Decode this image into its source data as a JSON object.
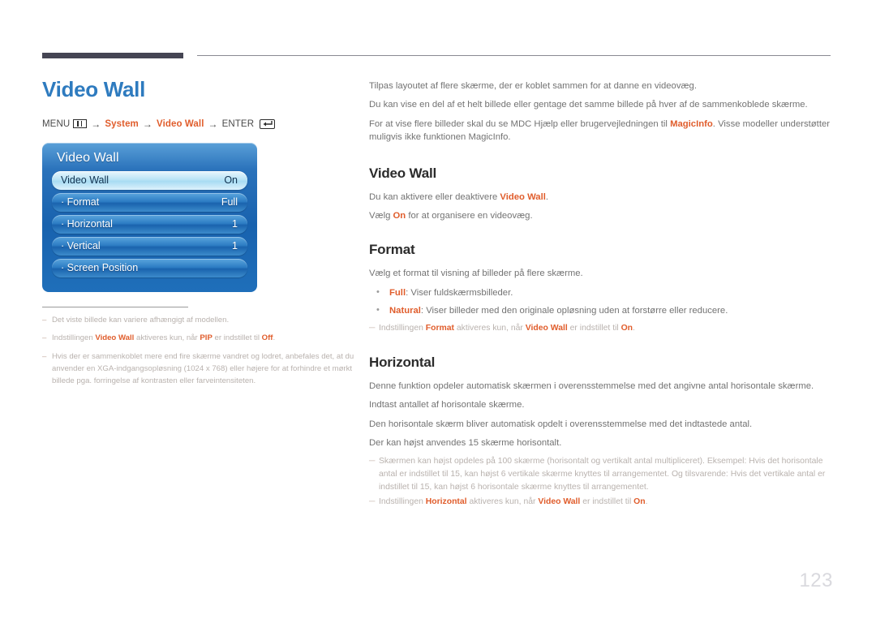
{
  "header": {
    "bar_color": "#454553",
    "line_color": "#8a8a92"
  },
  "left": {
    "page_title": "Video Wall",
    "title_color": "#2e7bbf",
    "breadcrumb": {
      "menu_label": "MENU",
      "menu_icon": "menu-bars-icon",
      "arrow": "→",
      "item1": "System",
      "item2": "Video Wall",
      "enter_label": "ENTER",
      "enter_icon": "enter-key-icon"
    },
    "osd": {
      "title": "Video Wall",
      "rows": [
        {
          "label": "Video Wall",
          "value": "On",
          "selected": true
        },
        {
          "label": "· Format",
          "value": "Full",
          "selected": false
        },
        {
          "label": "· Horizontal",
          "value": "1",
          "selected": false
        },
        {
          "label": "· Vertical",
          "value": "1",
          "selected": false
        },
        {
          "label": "· Screen Position",
          "value": "",
          "selected": false
        }
      ]
    },
    "notes": [
      {
        "dash": "–",
        "parts": [
          {
            "t": "Det viste billede kan variere afhængigt af modellen.",
            "b": false
          }
        ]
      },
      {
        "dash": "–",
        "parts": [
          {
            "t": "Indstillingen ",
            "b": false
          },
          {
            "t": "Video Wall",
            "b": true
          },
          {
            "t": " aktiveres kun, når ",
            "b": false
          },
          {
            "t": "PIP",
            "b": true
          },
          {
            "t": " er indstillet til ",
            "b": false
          },
          {
            "t": "Off",
            "b": true
          },
          {
            "t": ".",
            "b": false
          }
        ]
      },
      {
        "dash": "–",
        "parts": [
          {
            "t": "Hvis der er sammenkoblet mere end fire skærme vandret og lodret, anbefales det, at du anvender en XGA-indgangsopløsning (1024 x 768) eller højere for at forhindre et mørkt billede pga. forringelse af kontrasten eller farveintensiteten.",
            "b": false
          }
        ]
      }
    ]
  },
  "right": {
    "intro": [
      {
        "parts": [
          {
            "t": "Tilpas layoutet af flere skærme, der er koblet sammen for at danne en videovæg.",
            "b": false
          }
        ]
      },
      {
        "parts": [
          {
            "t": "Du kan vise en del af et helt billede eller gentage det samme billede på hver af de sammenkoblede skærme.",
            "b": false
          }
        ]
      },
      {
        "parts": [
          {
            "t": "For at vise flere billeder skal du se MDC Hjælp eller brugervejledningen til ",
            "b": false
          },
          {
            "t": "MagicInfo",
            "b": true
          },
          {
            "t": ". Visse modeller understøtter muligvis ikke funktionen MagicInfo.",
            "b": false
          }
        ]
      }
    ],
    "sections": [
      {
        "heading": "Video Wall",
        "paras": [
          {
            "parts": [
              {
                "t": "Du kan aktivere eller deaktivere ",
                "b": false
              },
              {
                "t": "Video Wall",
                "b": true
              },
              {
                "t": ".",
                "b": false
              }
            ]
          },
          {
            "parts": [
              {
                "t": "Vælg ",
                "b": false
              },
              {
                "t": "On",
                "b": true
              },
              {
                "t": " for at organisere en videovæg.",
                "b": false
              }
            ]
          }
        ],
        "bullets": [],
        "notes": []
      },
      {
        "heading": "Format",
        "paras": [
          {
            "parts": [
              {
                "t": "Vælg et format til visning af billeder på flere skærme.",
                "b": false
              }
            ]
          }
        ],
        "bullets": [
          {
            "dot": "•",
            "parts": [
              {
                "t": "Full",
                "b": true
              },
              {
                "t": ": Viser fuldskærmsbilleder.",
                "b": false
              }
            ]
          },
          {
            "dot": "•",
            "parts": [
              {
                "t": "Natural",
                "b": true
              },
              {
                "t": ": Viser billeder med den originale opløsning uden at forstørre eller reducere.",
                "b": false
              }
            ]
          }
        ],
        "notes": [
          {
            "dash": "─",
            "parts": [
              {
                "t": "Indstillingen ",
                "b": false
              },
              {
                "t": "Format",
                "b": true
              },
              {
                "t": " aktiveres kun, når ",
                "b": false
              },
              {
                "t": "Video Wall",
                "b": true
              },
              {
                "t": " er indstillet til ",
                "b": false
              },
              {
                "t": "On",
                "b": true
              },
              {
                "t": ".",
                "b": false
              }
            ]
          }
        ]
      },
      {
        "heading": "Horizontal",
        "paras": [
          {
            "parts": [
              {
                "t": "Denne funktion opdeler automatisk skærmen i overensstemmelse med det angivne antal horisontale skærme.",
                "b": false
              }
            ]
          },
          {
            "parts": [
              {
                "t": "Indtast antallet af horisontale skærme.",
                "b": false
              }
            ]
          },
          {
            "parts": [
              {
                "t": "Den horisontale skærm bliver automatisk opdelt i overensstemmelse med det indtastede antal.",
                "b": false
              }
            ]
          },
          {
            "parts": [
              {
                "t": "Der kan højst anvendes 15 skærme horisontalt.",
                "b": false
              }
            ]
          }
        ],
        "bullets": [],
        "notes": [
          {
            "dash": "─",
            "parts": [
              {
                "t": "Skærmen kan højst opdeles på 100 skærme (horisontalt og vertikalt antal multipliceret). Eksempel: Hvis det horisontale antal er indstillet til 15, kan højst 6 vertikale skærme knyttes til arrangementet. Og tilsvarende: Hvis det vertikale antal er indstillet til 15, kan højst 6 horisontale skærme knyttes til arrangementet.",
                "b": false
              }
            ]
          },
          {
            "dash": "─",
            "parts": [
              {
                "t": "Indstillingen ",
                "b": false
              },
              {
                "t": "Horizontal",
                "b": true
              },
              {
                "t": " aktiveres kun, når ",
                "b": false
              },
              {
                "t": "Video Wall",
                "b": true
              },
              {
                "t": " er indstillet til ",
                "b": false
              },
              {
                "t": "On",
                "b": true
              },
              {
                "t": ".",
                "b": false
              }
            ]
          }
        ]
      }
    ]
  },
  "footer": {
    "page_number": "123"
  },
  "colors": {
    "accent_orange": "#e05d2c",
    "title_blue": "#2e7bbf",
    "body_gray": "#737373",
    "note_gray": "#b9b2ae"
  }
}
